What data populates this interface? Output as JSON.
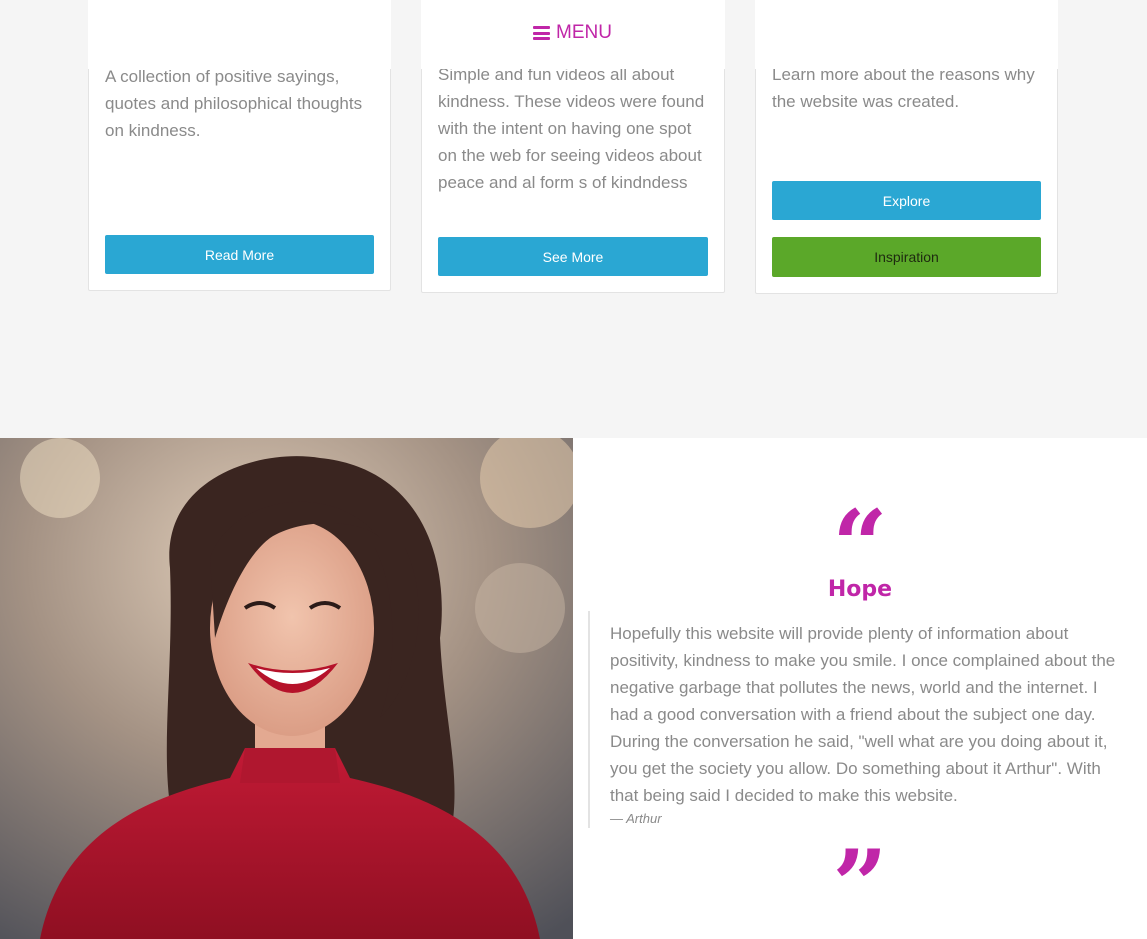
{
  "nav": {
    "menu_label": "MENU",
    "menu_icon": "bars-icon",
    "accent": "#c026a8"
  },
  "cards": [
    {
      "text": "A collection of positive sayings, quotes and philosophical thoughts on kindness.",
      "button": "Read More"
    },
    {
      "text": "Simple and fun videos all about kindness. These videos were found with the intent on having one spot on the web for seeing videos about peace and al form s of kindndess",
      "button": "See More"
    },
    {
      "text": "Learn more about the reasons why the website was created.",
      "buttons": [
        "Explore",
        "Inspiration"
      ]
    }
  ],
  "quote": {
    "open_icon": "quote-open-icon",
    "title": "Hope",
    "body": "Hopefully this website will provide plenty of information about positivity, kindness to make you smile. I once complained about the negative garbage that pollutes the news, world and the internet. I had a good conversation with a friend about the subject one day. During the conversation he said, \"well what are you doing about it, you get the society you allow. Do something about it Arthur\". With that being said I decided to make this website.",
    "author": "— Arthur",
    "close_icon": "quote-close-icon"
  },
  "colors": {
    "button_blue": "#2aa7d3",
    "button_green": "#5ba829",
    "text_gray": "#8a8a8a"
  }
}
